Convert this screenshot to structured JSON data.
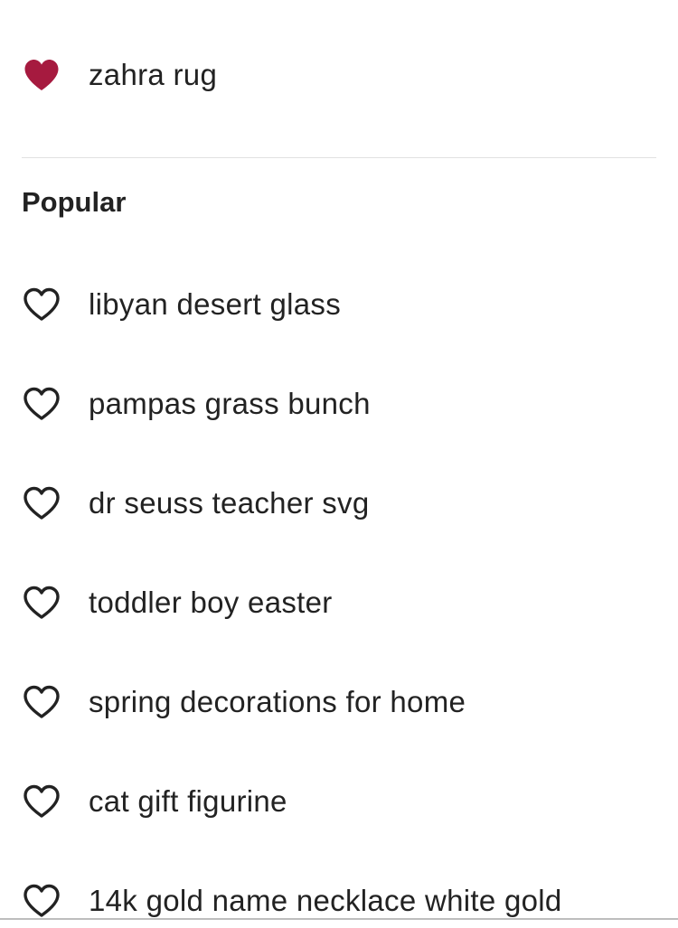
{
  "favorites": [
    {
      "label": "zahra rug",
      "icon": "heart-filled-icon"
    }
  ],
  "popular": {
    "heading": "Popular",
    "items": [
      {
        "label": "libyan desert glass",
        "icon": "heart-outline-icon"
      },
      {
        "label": "pampas grass bunch",
        "icon": "heart-outline-icon"
      },
      {
        "label": "dr seuss teacher svg",
        "icon": "heart-outline-icon"
      },
      {
        "label": "toddler boy easter",
        "icon": "heart-outline-icon"
      },
      {
        "label": "spring decorations for home",
        "icon": "heart-outline-icon"
      },
      {
        "label": "cat gift figurine",
        "icon": "heart-outline-icon"
      },
      {
        "label": "14k gold name necklace white gold",
        "icon": "heart-outline-icon"
      }
    ]
  },
  "colors": {
    "heart_filled": "#A61A3F",
    "heart_outline": "#222222",
    "text": "#222222",
    "divider": "#E1E1E1"
  }
}
